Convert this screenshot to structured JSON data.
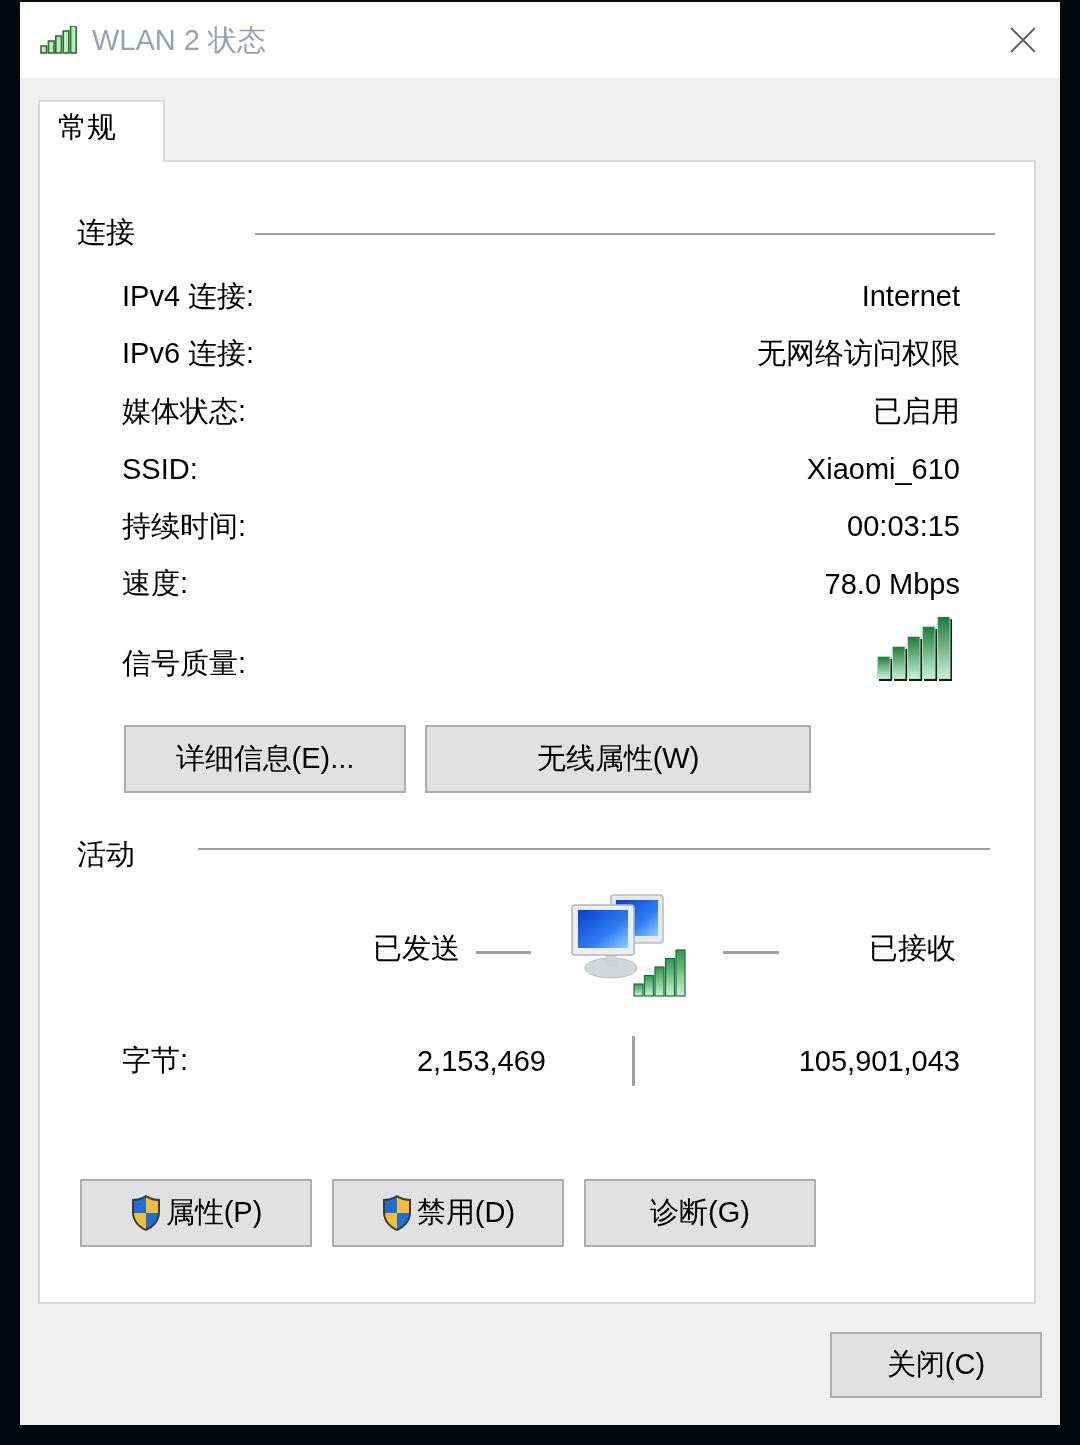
{
  "window": {
    "title": "WLAN 2 状态"
  },
  "tabs": [
    {
      "label": "常规",
      "selected": true
    }
  ],
  "connection": {
    "heading": "连接",
    "rows": [
      {
        "kind": "text",
        "label": "IPv4 连接:",
        "value": "Internet"
      },
      {
        "kind": "text",
        "label": "IPv6 连接:",
        "value": "无网络访问权限"
      },
      {
        "kind": "text",
        "label": "媒体状态:",
        "value": "已启用"
      },
      {
        "kind": "text",
        "label": "SSID:",
        "value": "Xiaomi_610"
      },
      {
        "kind": "text",
        "label": "持续时间:",
        "value": "00:03:15"
      },
      {
        "kind": "text",
        "label": "速度:",
        "value": "78.0 Mbps"
      },
      {
        "kind": "signal",
        "label": "信号质量:"
      }
    ],
    "buttons": [
      {
        "label": "详细信息(E)..."
      },
      {
        "label": "无线属性(W)"
      }
    ]
  },
  "activity": {
    "heading": "活动",
    "sent_label": "已发送",
    "received_label": "已接收",
    "bytes": {
      "label": "字节:",
      "sent": "2,153,469",
      "received": "105,901,043"
    }
  },
  "actions": [
    {
      "label": "属性(P)",
      "shield": true
    },
    {
      "label": "禁用(D)",
      "shield": true
    },
    {
      "label": "诊断(G)",
      "shield": false
    }
  ],
  "footer": {
    "buttons": [
      {
        "label": "关闭(C)"
      }
    ]
  }
}
